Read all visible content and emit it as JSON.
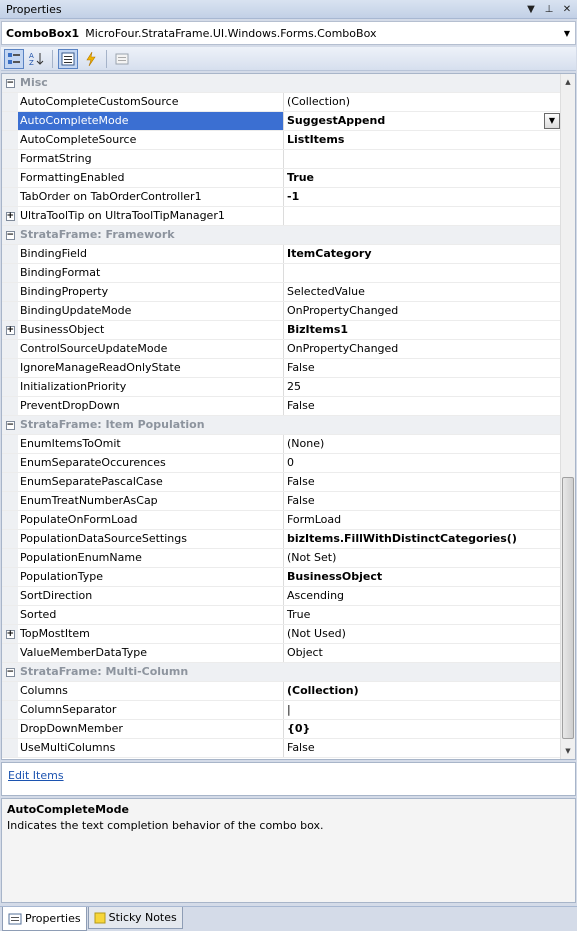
{
  "window": {
    "title": "Properties",
    "buttons": {
      "dropdown": "▼",
      "pin": "⊥",
      "close": "✕"
    }
  },
  "object_selector": {
    "name": "ComboBox1",
    "type": "MicroFour.StrataFrame.UI.Windows.Forms.ComboBox"
  },
  "toolbar": {
    "items": [
      "categorized-icon",
      "alphabetical-icon",
      "properties-icon",
      "events-icon",
      "property-pages-icon"
    ]
  },
  "grid": {
    "rows": [
      {
        "kind": "cat",
        "name": "Misc",
        "expander": "−"
      },
      {
        "name": "AutoCompleteCustomSource",
        "value": "(Collection)",
        "bold": false
      },
      {
        "name": "AutoCompleteMode",
        "value": "SuggestAppend",
        "bold": true,
        "selected": true
      },
      {
        "name": "AutoCompleteSource",
        "value": "ListItems",
        "bold": true
      },
      {
        "name": "FormatString",
        "value": "",
        "bold": false
      },
      {
        "name": "FormattingEnabled",
        "value": "True",
        "bold": true
      },
      {
        "name": "TabOrder on TabOrderController1",
        "value": "-1",
        "bold": true
      },
      {
        "name": "UltraToolTip on UltraToolTipManager1",
        "value": "",
        "bold": false,
        "expander": "+"
      },
      {
        "kind": "cat",
        "name": "StrataFrame: Framework",
        "expander": "−"
      },
      {
        "name": "BindingField",
        "value": "ItemCategory",
        "bold": true
      },
      {
        "name": "BindingFormat",
        "value": "",
        "bold": false
      },
      {
        "name": "BindingProperty",
        "value": "SelectedValue",
        "bold": false
      },
      {
        "name": "BindingUpdateMode",
        "value": "OnPropertyChanged",
        "bold": false
      },
      {
        "name": "BusinessObject",
        "value": "BizItems1",
        "bold": true,
        "expander": "+"
      },
      {
        "name": "ControlSourceUpdateMode",
        "value": "OnPropertyChanged",
        "bold": false
      },
      {
        "name": "IgnoreManageReadOnlyState",
        "value": "False",
        "bold": false
      },
      {
        "name": "InitializationPriority",
        "value": "25",
        "bold": false
      },
      {
        "name": "PreventDropDown",
        "value": "False",
        "bold": false
      },
      {
        "kind": "cat",
        "name": "StrataFrame: Item Population",
        "expander": "−"
      },
      {
        "name": "EnumItemsToOmit",
        "value": "(None)",
        "bold": false
      },
      {
        "name": "EnumSeparateOccurences",
        "value": "0",
        "bold": false
      },
      {
        "name": "EnumSeparatePascalCase",
        "value": "False",
        "bold": false
      },
      {
        "name": "EnumTreatNumberAsCap",
        "value": "False",
        "bold": false
      },
      {
        "name": "PopulateOnFormLoad",
        "value": "FormLoad",
        "bold": false
      },
      {
        "name": "PopulationDataSourceSettings",
        "value": "bizItems.FillWithDistinctCategories()",
        "bold": true
      },
      {
        "name": "PopulationEnumName",
        "value": "(Not Set)",
        "bold": false
      },
      {
        "name": "PopulationType",
        "value": "BusinessObject",
        "bold": true
      },
      {
        "name": "SortDirection",
        "value": "Ascending",
        "bold": false
      },
      {
        "name": "Sorted",
        "value": "True",
        "bold": false
      },
      {
        "name": "TopMostItem",
        "value": "(Not Used)",
        "bold": false,
        "expander": "+"
      },
      {
        "name": "ValueMemberDataType",
        "value": "Object",
        "bold": false
      },
      {
        "kind": "cat",
        "name": "StrataFrame: Multi-Column",
        "expander": "−"
      },
      {
        "name": "Columns",
        "value": "(Collection)",
        "bold": true
      },
      {
        "name": "ColumnSeparator",
        "value": "|",
        "bold": false
      },
      {
        "name": "DropDownMember",
        "value": "{0}",
        "bold": true
      },
      {
        "name": "UseMultiColumns",
        "value": "False",
        "bold": false
      }
    ]
  },
  "commands": {
    "edit_items": "Edit Items"
  },
  "description": {
    "title": "AutoCompleteMode",
    "text": "Indicates the text completion behavior of the combo box."
  },
  "tabs": [
    {
      "label": "Properties",
      "icon": "properties-tab-icon",
      "active": true
    },
    {
      "label": "Sticky Notes",
      "icon": "sticky-notes-icon",
      "active": false
    }
  ]
}
